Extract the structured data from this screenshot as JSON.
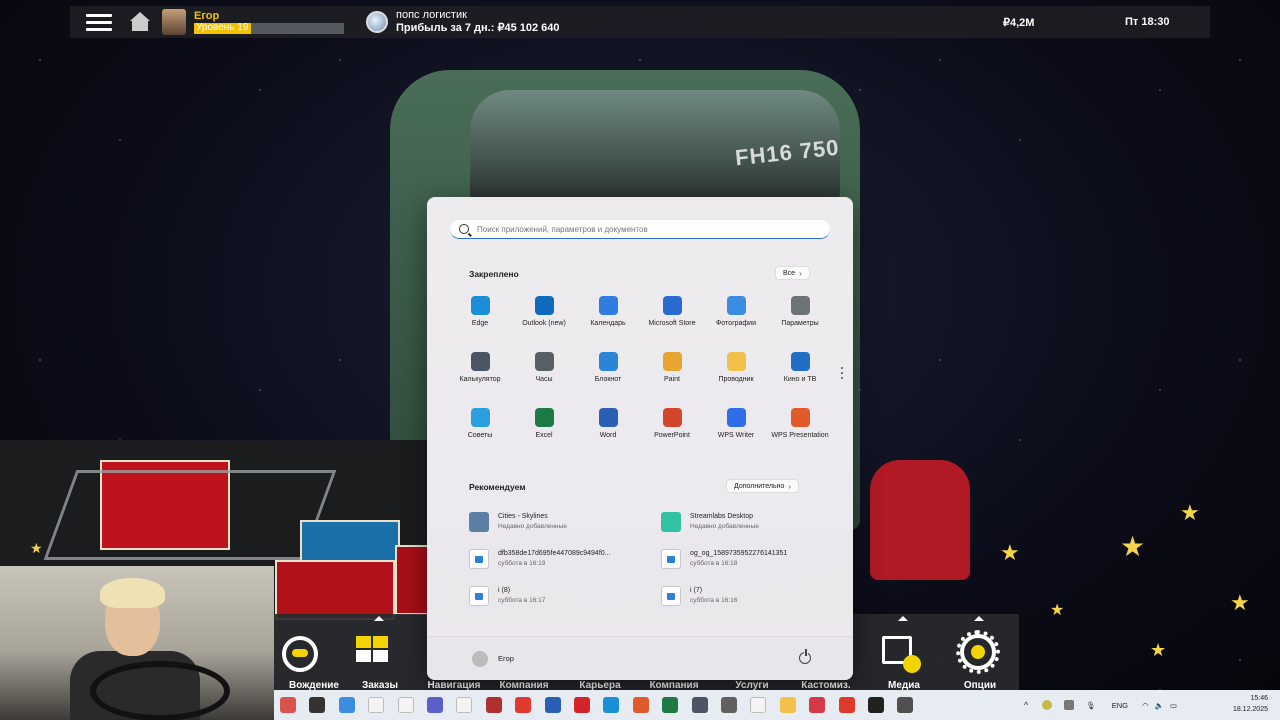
{
  "hud": {
    "player_name": "Егор",
    "level_label": "Уровень 19",
    "level_progress": 0.38,
    "company_name": "попс логистик",
    "profit": "Прибыль за 7 дн.: ₽45 102 640",
    "money": "₽4,2M",
    "time": "Пт 18:30"
  },
  "truck_badge": "FH16 750",
  "start_menu": {
    "search_placeholder": "Поиск приложений, параметров и документов",
    "pinned_title": "Закреплено",
    "all_button": "Все",
    "pinned": [
      {
        "name": "Edge",
        "icon": "edge-icon",
        "color": "#1a8fd8"
      },
      {
        "name": "Outlook (new)",
        "icon": "outlook-icon",
        "color": "#0f6cbd"
      },
      {
        "name": "Календарь",
        "icon": "calendar-icon",
        "color": "#2f7de1"
      },
      {
        "name": "Microsoft Store",
        "icon": "store-icon",
        "color": "#2a6bd1"
      },
      {
        "name": "Фотографии",
        "icon": "photos-icon",
        "color": "#3a8de0"
      },
      {
        "name": "Параметры",
        "icon": "settings-icon",
        "color": "#6e7378"
      },
      {
        "name": "Калькулятор",
        "icon": "calculator-icon",
        "color": "#4b5563"
      },
      {
        "name": "Часы",
        "icon": "clock-icon",
        "color": "#5a5f66"
      },
      {
        "name": "Блокнот",
        "icon": "notepad-icon",
        "color": "#2b84d6"
      },
      {
        "name": "Paint",
        "icon": "paint-icon",
        "color": "#e9a531"
      },
      {
        "name": "Проводник",
        "icon": "folder-icon",
        "color": "#f2c14a"
      },
      {
        "name": "Кино и ТВ",
        "icon": "movies-icon",
        "color": "#1f6fc4"
      },
      {
        "name": "Советы",
        "icon": "tips-icon",
        "color": "#2a9fe0"
      },
      {
        "name": "Excel",
        "icon": "excel-icon",
        "color": "#1d7a45"
      },
      {
        "name": "Word",
        "icon": "word-icon",
        "color": "#2b5fb5"
      },
      {
        "name": "PowerPoint",
        "icon": "powerpoint-icon",
        "color": "#d2472b"
      },
      {
        "name": "WPS Writer",
        "icon": "wps-writer-icon",
        "color": "#2f6ee8"
      },
      {
        "name": "WPS Presentation",
        "icon": "wps-presentation-icon",
        "color": "#e05a2a"
      }
    ],
    "recommended_title": "Рекомендуем",
    "more_button": "Дополнительно",
    "recommended": [
      {
        "title": "Cities - Skylines",
        "subtitle": "Недавно добавленные",
        "icon": "cities-skylines-icon",
        "color": "#5b7fa6"
      },
      {
        "title": "Streamlabs Desktop",
        "subtitle": "Недавно добавленные",
        "icon": "streamlabs-icon",
        "color": "#31c3a2"
      },
      {
        "title": "dfb358de17d695fe447089c9494f0...",
        "subtitle": "суббота в 16:19",
        "icon": "image-file-icon",
        "color": "#2e7fd6"
      },
      {
        "title": "og_og_1589735952276141351",
        "subtitle": "суббота в 16:18",
        "icon": "image-file-icon",
        "color": "#2e7fd6"
      },
      {
        "title": "i (8)",
        "subtitle": "суббота в 16:17",
        "icon": "file-icon",
        "color": "#c8c8c8"
      },
      {
        "title": "i (7)",
        "subtitle": "суббота в 16:16",
        "icon": "file-icon",
        "color": "#c8c8c8"
      }
    ],
    "user_name": "Егор"
  },
  "game_menu": {
    "buttons": [
      {
        "label": "Вождение",
        "icon": "steering-wheel-icon"
      },
      {
        "label": "Заказы",
        "icon": "cargo-icon"
      },
      {
        "label": "Навигация",
        "icon": ""
      },
      {
        "label": "Компания",
        "icon": ""
      },
      {
        "label": "Карьера",
        "icon": ""
      },
      {
        "label": "Компания",
        "icon": ""
      },
      {
        "label": "Услуги",
        "icon": ""
      },
      {
        "label": "Кастомиз.",
        "icon": ""
      },
      {
        "label": "Медиа",
        "icon": "photo-icon"
      },
      {
        "label": "Опции",
        "icon": "gear-icon"
      }
    ]
  },
  "taskbar": {
    "apps": [
      {
        "icon": "game-app-icon",
        "color": "#d9534f"
      },
      {
        "icon": "task-view-icon",
        "color": "#333333"
      },
      {
        "icon": "keyboard-app-icon",
        "color": "#3a8de0"
      },
      {
        "icon": "file-icon",
        "color": "#f4f4f4"
      },
      {
        "icon": "file-icon",
        "color": "#f4f4f4"
      },
      {
        "icon": "teams-icon",
        "color": "#5b5fc7"
      },
      {
        "icon": "file-icon",
        "color": "#f4f4f4"
      },
      {
        "icon": "truck-app-icon",
        "color": "#b03030"
      },
      {
        "icon": "yandex-icon",
        "color": "#e03a2f"
      },
      {
        "icon": "word-icon",
        "color": "#2b5fb5"
      },
      {
        "icon": "wps-icon",
        "color": "#d4232b"
      },
      {
        "icon": "edge-icon",
        "color": "#1a8fd8"
      },
      {
        "icon": "wps-presentation-icon",
        "color": "#e05a2a"
      },
      {
        "icon": "excel-icon",
        "color": "#1d7a45"
      },
      {
        "icon": "calculator-icon",
        "color": "#4b5563"
      },
      {
        "icon": "truck-app-icon",
        "color": "#606060"
      },
      {
        "icon": "file-icon",
        "color": "#f4f4f4"
      },
      {
        "icon": "folder-icon",
        "color": "#f2c14a"
      },
      {
        "icon": "streaming-icon",
        "color": "#d43a4a"
      },
      {
        "icon": "yandex-browser-icon",
        "color": "#e03a2f"
      },
      {
        "icon": "obs-icon",
        "color": "#202020"
      },
      {
        "icon": "truck-app-icon",
        "color": "#505050"
      }
    ],
    "lang": "ENG",
    "time": "15:46",
    "date": "18.12.2025"
  }
}
